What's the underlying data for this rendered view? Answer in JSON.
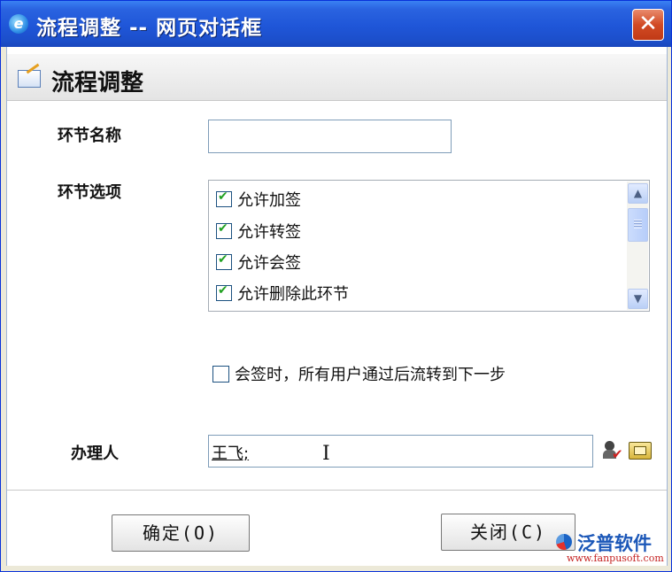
{
  "window": {
    "title": "流程调整 -- 网页对话框",
    "close_glyph": "✕"
  },
  "header": {
    "title": "流程调整"
  },
  "form": {
    "node_name": {
      "label": "环节名称",
      "value": ""
    },
    "node_options": {
      "label": "环节选项",
      "items": [
        {
          "label": "允许加签",
          "checked": true
        },
        {
          "label": "允许转签",
          "checked": true
        },
        {
          "label": "允许会签",
          "checked": true
        },
        {
          "label": "允许删除此环节",
          "checked": true
        }
      ]
    },
    "countersign_rule": {
      "label": "会签时，所有用户通过后流转到下一步",
      "checked": false
    },
    "handler": {
      "label": "办理人",
      "value": "王飞;"
    }
  },
  "buttons": {
    "ok": "确定(O)",
    "close": "关闭(C)"
  },
  "watermark": {
    "name": "泛普软件",
    "url": "www.fanpusoft.com"
  },
  "icons": {
    "scroll_up": "▲",
    "scroll_down": "▼",
    "cursor": "I",
    "user_check": "✔"
  }
}
